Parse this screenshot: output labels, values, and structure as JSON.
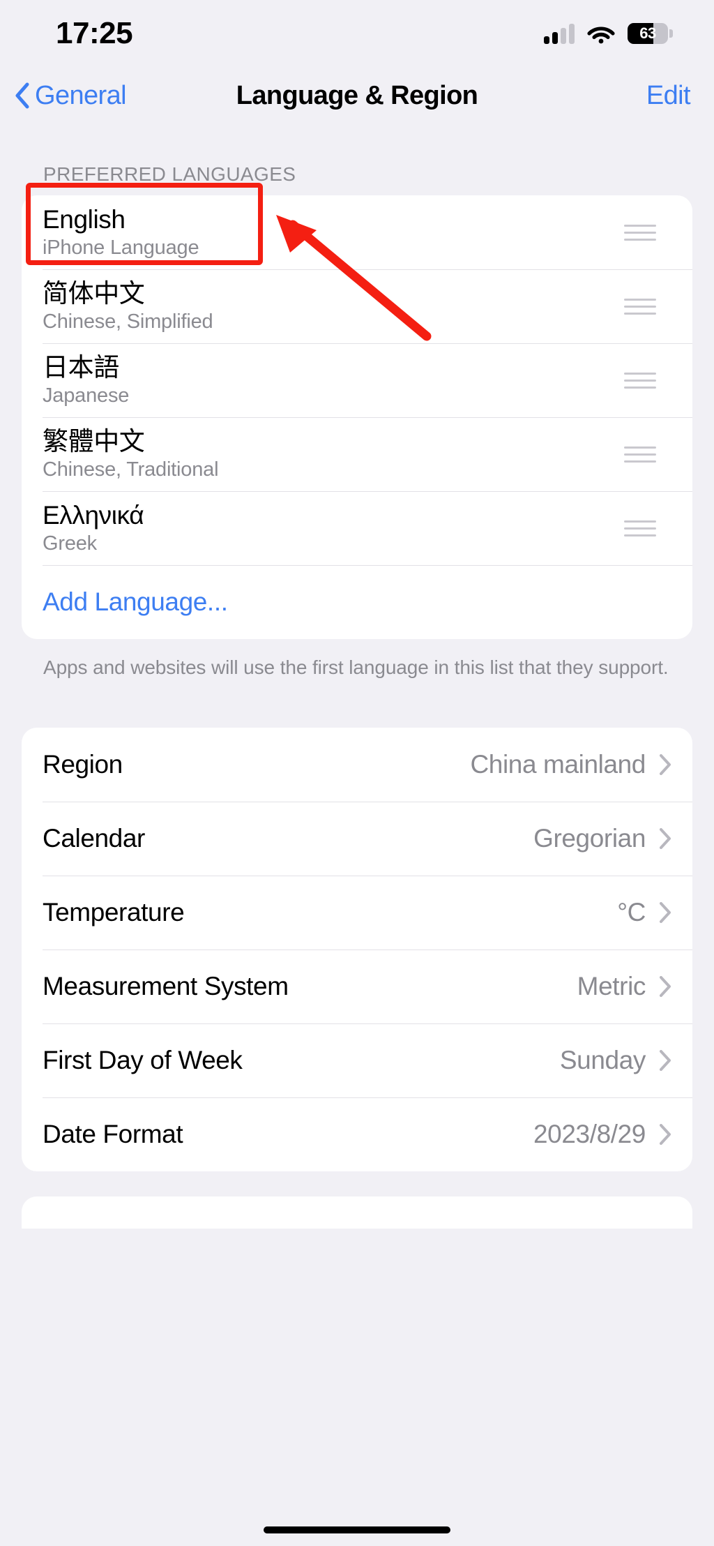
{
  "status_bar": {
    "time": "17:25",
    "cellular_icon": "cellular-signal-icon",
    "wifi_icon": "wifi-icon",
    "battery_icon": "battery-icon",
    "battery_percent": "63",
    "battery_level": 63
  },
  "nav": {
    "back_icon": "chevron-left-icon",
    "back_label": "General",
    "title": "Language & Region",
    "edit_label": "Edit"
  },
  "languages_section": {
    "header": "PREFERRED LANGUAGES",
    "items": [
      {
        "name": "English",
        "subtitle": "iPhone Language",
        "handle_icon": "reorder-handle-icon"
      },
      {
        "name": "简体中文",
        "subtitle": "Chinese, Simplified",
        "handle_icon": "reorder-handle-icon"
      },
      {
        "name": "日本語",
        "subtitle": "Japanese",
        "handle_icon": "reorder-handle-icon"
      },
      {
        "name": "繁體中文",
        "subtitle": "Chinese, Traditional",
        "handle_icon": "reorder-handle-icon"
      },
      {
        "name": "Ελληνικά",
        "subtitle": "Greek",
        "handle_icon": "reorder-handle-icon"
      }
    ],
    "add_language_label": "Add Language...",
    "footnote": "Apps and websites will use the first language in this list that they support."
  },
  "region_section": {
    "rows": [
      {
        "label": "Region",
        "value": "China mainland",
        "chevron": "chevron-right-icon"
      },
      {
        "label": "Calendar",
        "value": "Gregorian",
        "chevron": "chevron-right-icon"
      },
      {
        "label": "Temperature",
        "value": "°C",
        "chevron": "chevron-right-icon"
      },
      {
        "label": "Measurement System",
        "value": "Metric",
        "chevron": "chevron-right-icon"
      },
      {
        "label": "First Day of Week",
        "value": "Sunday",
        "chevron": "chevron-right-icon"
      },
      {
        "label": "Date Format",
        "value": "2023/8/29",
        "chevron": "chevron-right-icon"
      }
    ]
  },
  "annotations": {
    "highlight_box": "red-highlight-box",
    "pointer_arrow": "red-arrow-pointer",
    "color": "#f41f12"
  },
  "colors": {
    "page_background": "#f1f0f5",
    "card_background": "#ffffff",
    "accent_blue": "#3d7ef2",
    "secondary_text": "#8a8a90",
    "separator": "#e2e1e6",
    "annotation_red": "#f41f12"
  }
}
